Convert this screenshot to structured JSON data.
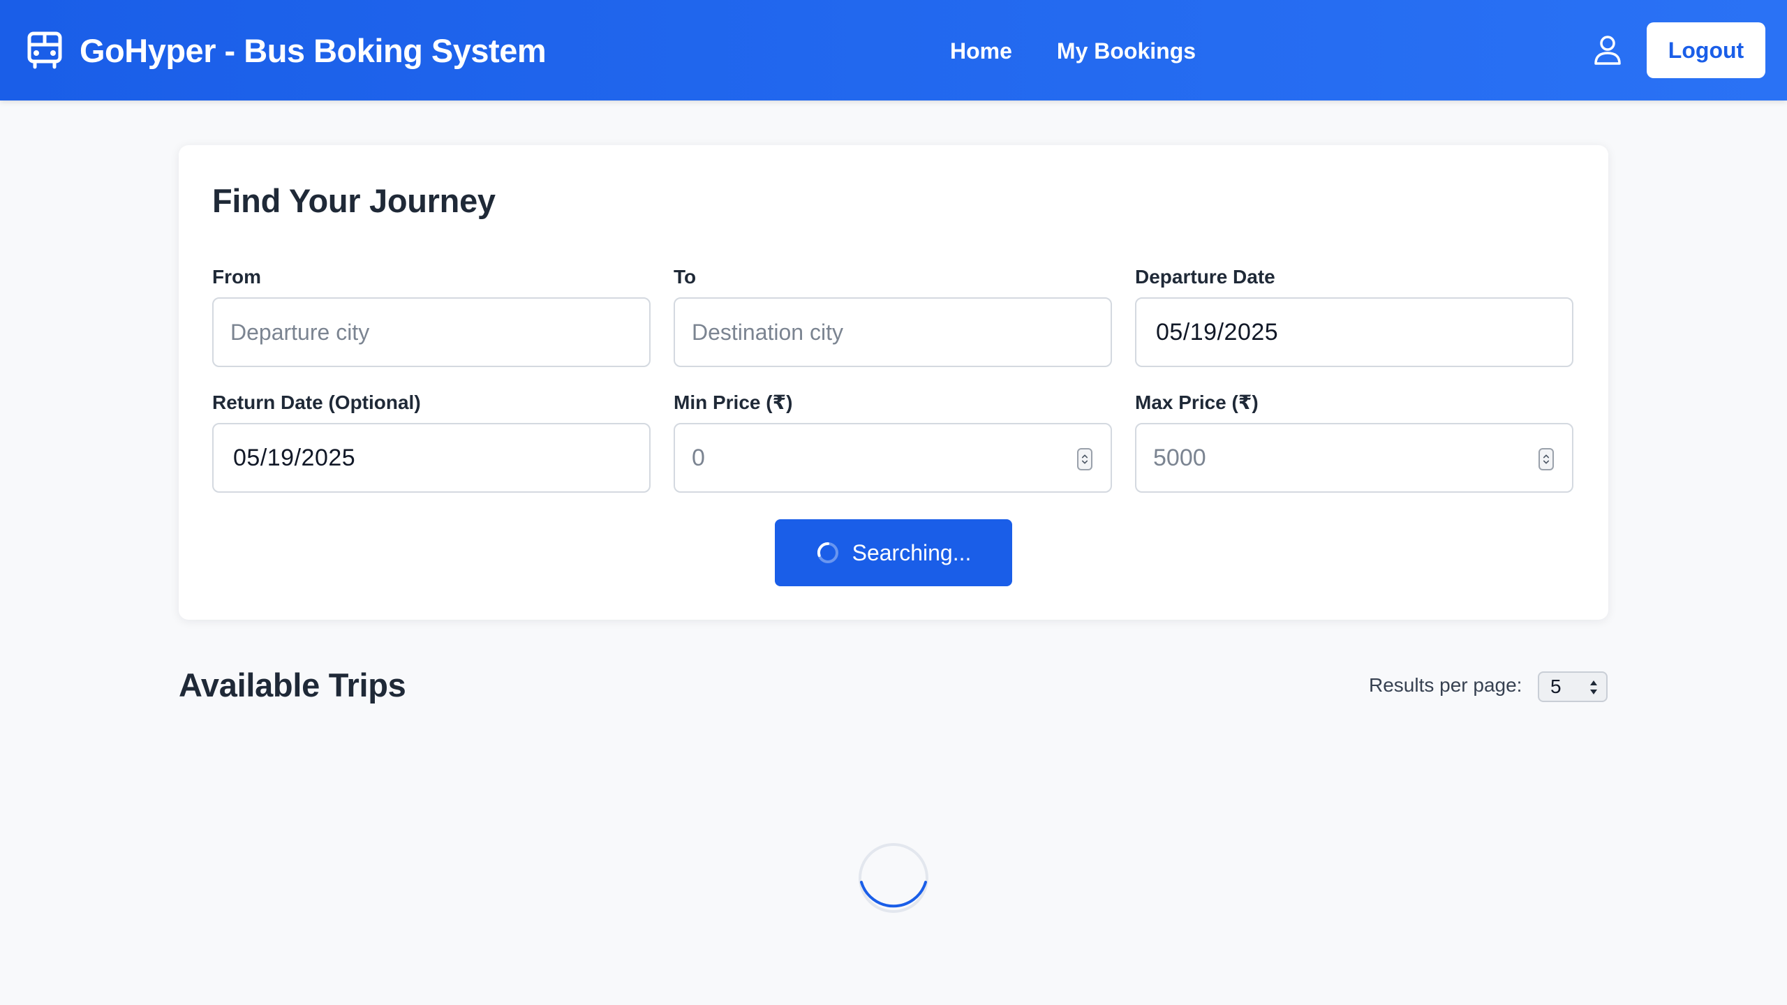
{
  "header": {
    "brand_icon": "bus-icon",
    "title": "GoHyper - Bus Boking System",
    "nav": [
      {
        "label": "Home"
      },
      {
        "label": "My Bookings"
      }
    ],
    "user_icon": "user-icon",
    "logout_label": "Logout"
  },
  "search": {
    "title": "Find Your Journey",
    "from": {
      "label": "From",
      "placeholder": "Departure city"
    },
    "to": {
      "label": "To",
      "placeholder": "Destination city"
    },
    "departure": {
      "label": "Departure Date",
      "value": "05/19/2025"
    },
    "return": {
      "label": "Return Date (Optional)",
      "value": "05/19/2025"
    },
    "min_price": {
      "label": "Min Price (₹)",
      "value": "0"
    },
    "max_price": {
      "label": "Max Price (₹)",
      "value": "5000"
    },
    "button_label": "Searching...",
    "button_state": "loading"
  },
  "results": {
    "title": "Available Trips",
    "per_page_label": "Results per page:",
    "per_page_value": "5",
    "state": "loading"
  },
  "colors": {
    "primary": "#1a5ee8",
    "header_gradient_end": "#2a72f5",
    "background": "#f8f9fb"
  }
}
